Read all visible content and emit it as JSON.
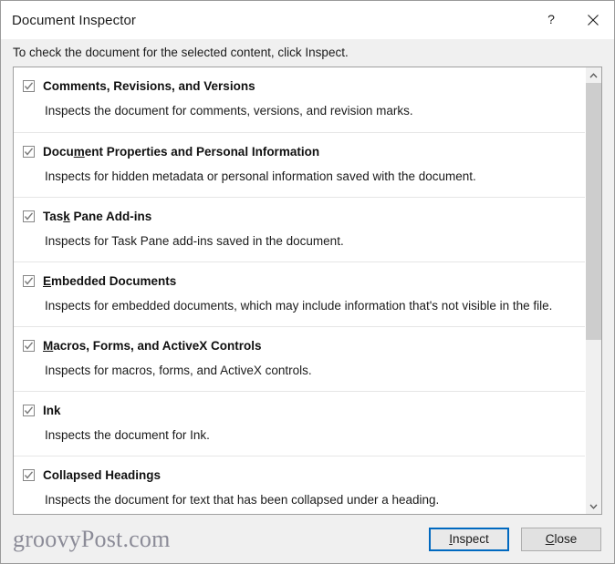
{
  "window": {
    "title": "Document Inspector",
    "help_icon": "question-mark-icon",
    "close_icon": "close-x-icon"
  },
  "instruction": "To check the document for the selected content, click Inspect.",
  "list": {
    "scrollbar": {
      "up_arrow": "chevron-up-icon",
      "down_arrow": "chevron-down-icon"
    },
    "items": [
      {
        "checked": true,
        "title_before": "C",
        "title_accel": "",
        "title": "Comments, Revisions, and Versions",
        "accel_index": -1,
        "description": "Inspects the document for comments, versions, and revision marks."
      },
      {
        "checked": true,
        "title": "Document Properties and Personal Information",
        "accel_index": 4,
        "description": "Inspects for hidden metadata or personal information saved with the document."
      },
      {
        "checked": true,
        "title": "Task Pane Add-ins",
        "accel_index": 3,
        "description": "Inspects for Task Pane add-ins saved in the document."
      },
      {
        "checked": true,
        "title": "Embedded Documents",
        "accel_index": 0,
        "description": "Inspects for embedded documents, which may include information that's not visible in the file."
      },
      {
        "checked": true,
        "title": "Macros, Forms, and ActiveX Controls",
        "accel_index": 0,
        "description": "Inspects for macros, forms, and ActiveX controls."
      },
      {
        "checked": true,
        "title": "Ink",
        "accel_index": -1,
        "description": "Inspects the document for Ink."
      },
      {
        "checked": true,
        "title": "Collapsed Headings",
        "accel_index": -1,
        "description": "Inspects the document for text that has been collapsed under a heading."
      }
    ]
  },
  "footer": {
    "watermark": "groovyPost.com",
    "inspect_button": {
      "label": "Inspect",
      "accel_index": 0,
      "focused": true
    },
    "close_button": {
      "label": "Close",
      "accel_index": 0,
      "focused": false
    }
  },
  "colors": {
    "accent": "#0069c0",
    "dialog_bg": "#f0f0f0",
    "list_bg": "#ffffff",
    "separator": "#e6e6e6",
    "scroll_thumb": "#cdcdcd",
    "watermark": "#8b8b97"
  }
}
